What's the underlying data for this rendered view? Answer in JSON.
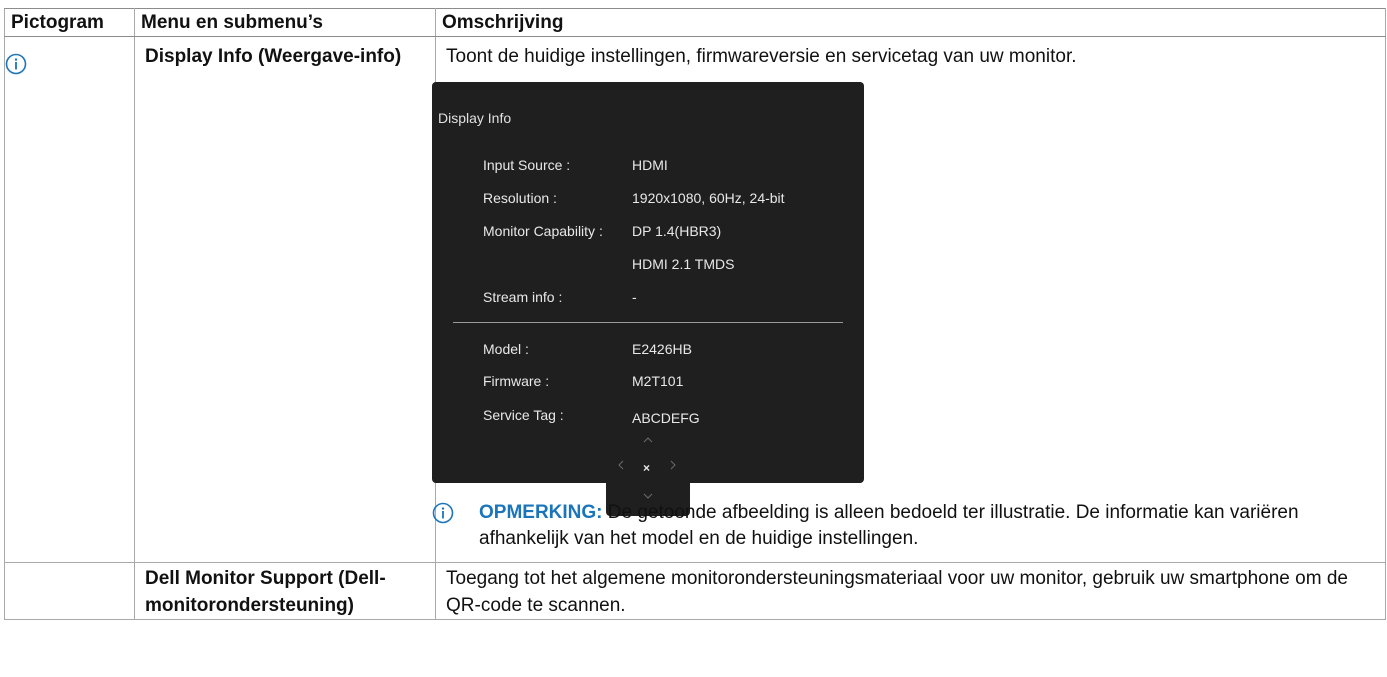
{
  "table": {
    "headers": {
      "icon": "Pictogram",
      "menu": "Menu en submenu’s",
      "description": "Omschrijving"
    },
    "rows": [
      {
        "icon": "info-icon",
        "menu": "Display Info (Weergave-info)",
        "description": "Toont de huidige instellingen, firmwareversie en servicetag van uw monitor.",
        "osd": {
          "title": "Display Info",
          "rows": [
            {
              "label": "Input Source :",
              "value": "HDMI"
            },
            {
              "label": "Resolution :",
              "value": "1920x1080, 60Hz, 24-bit"
            },
            {
              "label": "Monitor Capability :",
              "value": "DP 1.4(HBR3)"
            },
            {
              "label": "",
              "value": "HDMI 2.1 TMDS"
            },
            {
              "label": "Stream info :",
              "value": "-"
            },
            {
              "label": "Model :",
              "value": "E2426HB"
            },
            {
              "label": "Firmware :",
              "value": "M2T101"
            },
            {
              "label": "Service Tag :",
              "value": "ABCDEFG"
            }
          ],
          "joystick": {
            "up": "^",
            "left": "<",
            "center": "×",
            "right": ">",
            "down": "v"
          }
        },
        "note": {
          "label": "OPMERKING:",
          "text": " De getoonde afbeelding is alleen bedoeld ter illustratie. De informatie kan variëren afhankelijk van het model en de huidige instellingen."
        }
      },
      {
        "icon": "",
        "menu": "Dell Monitor Support (Dell-monitorondersteuning)",
        "description": "Toegang tot het algemene monitorondersteuningsmateriaal voor uw monitor, gebruik uw smartphone om de QR-code te scannen."
      }
    ]
  },
  "colors": {
    "border": "#a9a9a9",
    "osd_background": "#1f1f1f",
    "note_accent": "#1b75bb",
    "icon_accent": "#1b75bb"
  }
}
